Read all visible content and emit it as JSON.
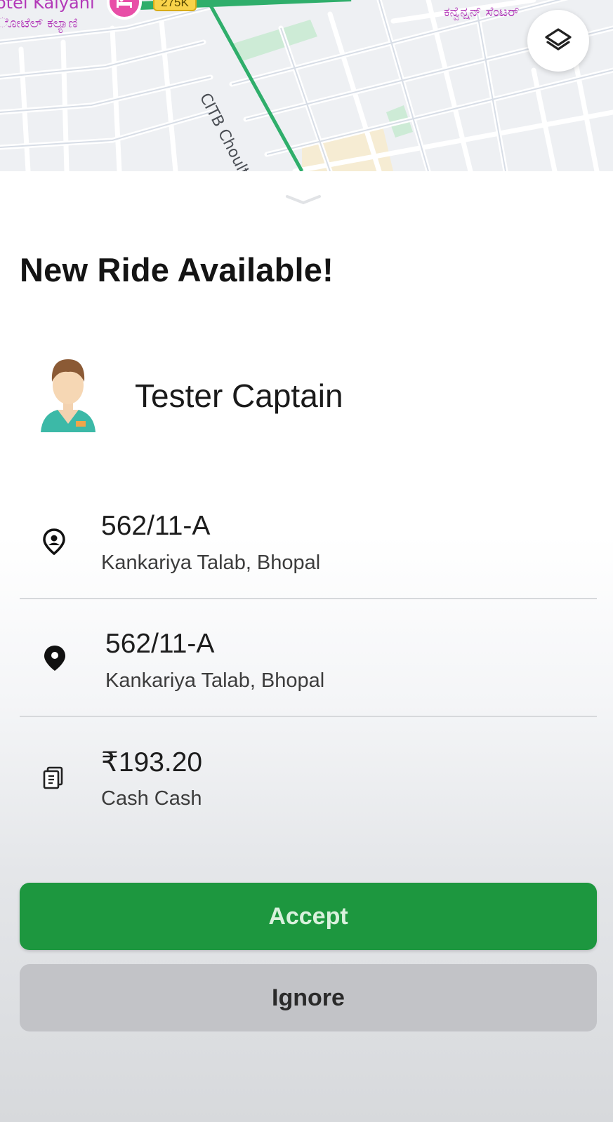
{
  "map": {
    "hotel_name_en": "otel Kalyani",
    "hotel_name_kn": "ೋಟೆಲ್ ಕಲ್ಯಾಣಿ",
    "convention_label_kn": "ಕನ್ವೆನ್ಷನ್ ಸೆಂಟರ್",
    "road_name": "CITB Choultry Rd",
    "road_badge": "275K",
    "layers_icon": "layers-icon"
  },
  "sheet": {
    "title": "New Ride Available!",
    "captain": {
      "name": "Tester Captain",
      "avatar_icon": "captain-avatar"
    },
    "pickup": {
      "icon": "pickup-pin-icon",
      "address": "562/11-A",
      "area": "Kankariya Talab, Bhopal"
    },
    "drop": {
      "icon": "drop-pin-icon",
      "address": "562/11-A",
      "area": "Kankariya Talab, Bhopal"
    },
    "fare": {
      "icon": "cash-icon",
      "amount": "₹193.20",
      "payment_mode": "Cash Cash"
    },
    "buttons": {
      "accept": "Accept",
      "ignore": "Ignore"
    },
    "colors": {
      "accept_bg": "#1d973f",
      "ignore_bg": "#c2c3c7",
      "route_green": "#2fae6b",
      "map_label_magenta": "#b238b8"
    }
  }
}
